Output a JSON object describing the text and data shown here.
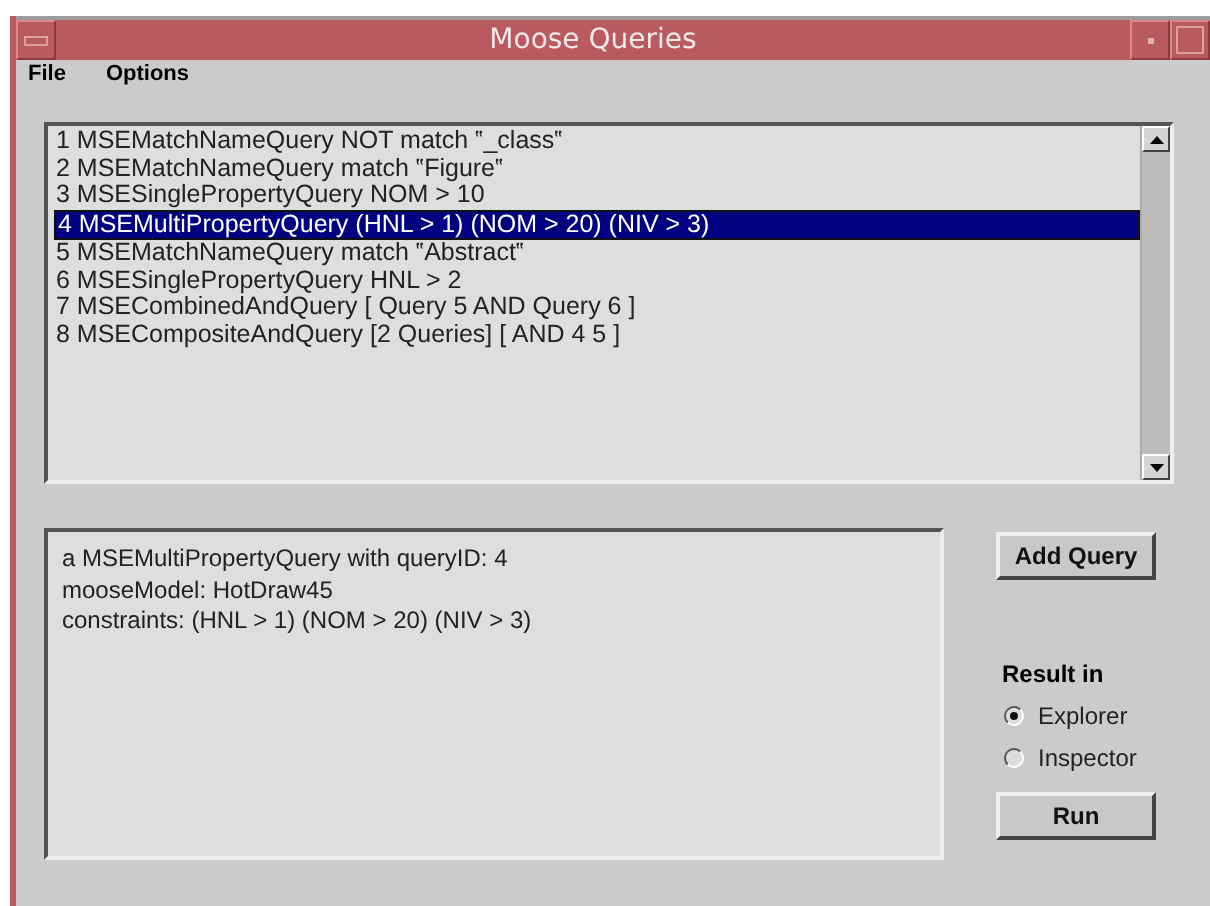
{
  "window": {
    "title": "Moose Queries"
  },
  "menu": [
    "File",
    "Options"
  ],
  "queries": [
    {
      "text": "1 MSEMatchNameQuery NOT match ‟_class‟",
      "selected": false
    },
    {
      "text": "2 MSEMatchNameQuery  match ‟Figure‟",
      "selected": false
    },
    {
      "text": "3 MSESinglePropertyQuery  NOM > 10",
      "selected": false
    },
    {
      "text": "4 MSEMultiPropertyQuery  (HNL > 1) (NOM > 20) (NIV > 3)",
      "selected": true
    },
    {
      "text": "5 MSEMatchNameQuery  match ‟Abstract‟",
      "selected": false
    },
    {
      "text": "6 MSESinglePropertyQuery  HNL > 2",
      "selected": false
    },
    {
      "text": "7 MSECombinedAndQuery [ Query 5 AND Query 6 ]",
      "selected": false
    },
    {
      "text": "8 MSECompositeAndQuery [2 Queries] [ AND 4 5 ]",
      "selected": false
    }
  ],
  "details": [
    "a MSEMultiPropertyQuery with queryID: 4",
    "mooseModel: HotDraw45",
    "constraints: (HNL > 1) (NOM > 20) (NIV > 3)"
  ],
  "add_button": "Add Query",
  "result_in": {
    "label": "Result in",
    "options": [
      {
        "label": "Explorer",
        "selected": true
      },
      {
        "label": "Inspector",
        "selected": false
      }
    ]
  },
  "run_button": "Run"
}
